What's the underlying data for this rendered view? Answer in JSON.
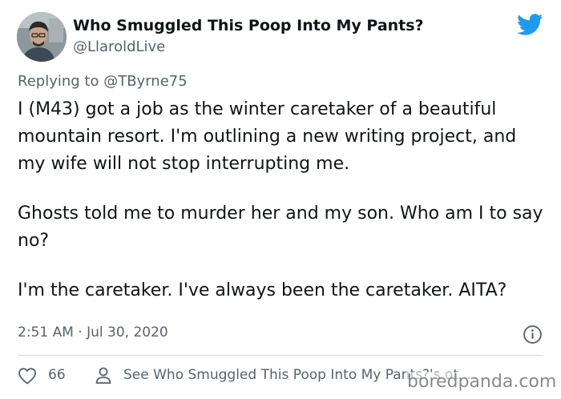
{
  "tweet": {
    "author_name": "Who Smuggled This Poop Into My Pants?",
    "author_handle": "@LlaroldLive",
    "replying_prefix": "Replying to ",
    "replying_to": "@TByrne75",
    "paragraphs": [
      "I (M43) got a job as the winter caretaker of a beautiful mountain resort. I'm outlining a new writing project, and my wife will not stop interrupting me.",
      "Ghosts told me to murder her and my son. Who am I to say no?",
      "I'm the caretaker. I've always been the caretaker. AITA?"
    ],
    "timestamp": "2:51 AM · Jul 30, 2020",
    "like_count": "66",
    "see_more_text": "See Who Smuggled This Poop Into My Pants?'s ot..."
  },
  "icons": {
    "brand": "twitter-bird-icon",
    "info": "info-icon",
    "like": "heart-icon",
    "profile": "person-icon"
  },
  "colors": {
    "brand_blue": "#1d9bf0",
    "text_primary": "#0f1419",
    "text_secondary": "#536471",
    "divider": "#cfd9de"
  },
  "watermark": "boredpanda.com"
}
